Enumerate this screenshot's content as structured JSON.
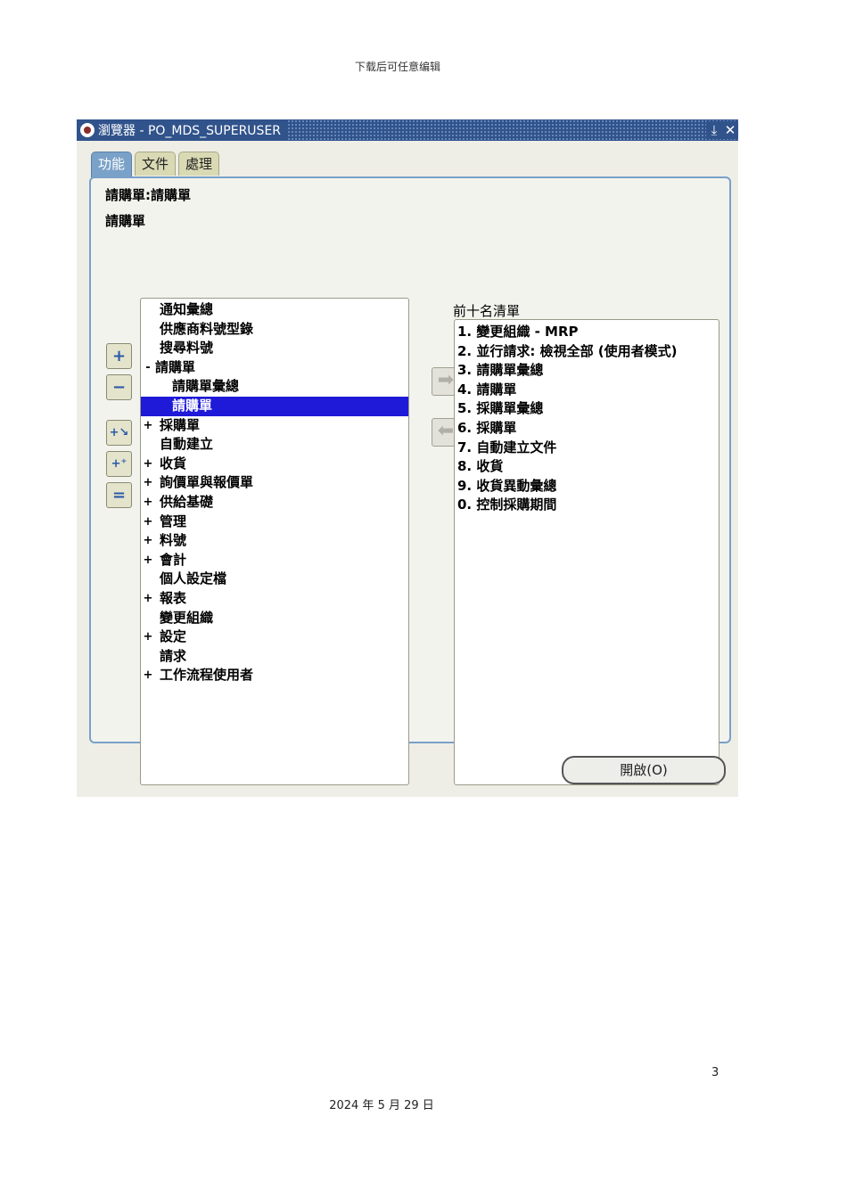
{
  "doc": {
    "header": "下载后可任意编辑",
    "page_number": "3",
    "footer": "2024 年 5 月 29 日"
  },
  "window": {
    "title": "瀏覽器 - PO_MDS_SUPERUSER",
    "tabs": [
      "功能",
      "文件",
      "處理"
    ],
    "active_tab": "功能",
    "path": "請購單:請購單",
    "subtitle": "請購單",
    "tree": [
      {
        "label": "通知彙總",
        "expander": "",
        "level": 0
      },
      {
        "label": "供應商料號型錄",
        "expander": "",
        "level": 0
      },
      {
        "label": "搜尋料號",
        "expander": "",
        "level": 0
      },
      {
        "label": "請購單",
        "expander": "-",
        "level": 0
      },
      {
        "label": "請購單彙總",
        "expander": "",
        "level": 1
      },
      {
        "label": "請購單",
        "expander": "",
        "level": 1,
        "selected": true
      },
      {
        "label": "採購單",
        "expander": "+",
        "level": 0
      },
      {
        "label": "自動建立",
        "expander": "",
        "level": 0
      },
      {
        "label": "收貨",
        "expander": "+",
        "level": 0
      },
      {
        "label": "詢價單與報價單",
        "expander": "+",
        "level": 0
      },
      {
        "label": "供給基礎",
        "expander": "+",
        "level": 0
      },
      {
        "label": "管理",
        "expander": "+",
        "level": 0
      },
      {
        "label": "料號",
        "expander": "+",
        "level": 0
      },
      {
        "label": "會計",
        "expander": "+",
        "level": 0
      },
      {
        "label": "個人設定檔",
        "expander": "",
        "level": 0
      },
      {
        "label": "報表",
        "expander": "+",
        "level": 0
      },
      {
        "label": "變更組織",
        "expander": "",
        "level": 0
      },
      {
        "label": "設定",
        "expander": "+",
        "level": 0
      },
      {
        "label": "請求",
        "expander": "",
        "level": 0
      },
      {
        "label": "工作流程使用者",
        "expander": "+",
        "level": 0
      }
    ],
    "top10_label": "前十名清單",
    "top10": [
      "1. 變更組織 - MRP",
      "2. 並行請求: 檢視全部 (使用者模式)",
      "3. 請購單彙總",
      "4. 請購單",
      "5. 採購單彙總",
      "6. 採購單",
      "7. 自動建立文件",
      "8. 收貨",
      "9. 收貨異動彙總",
      "0. 控制採購期間"
    ],
    "buttons": {
      "expand": "+",
      "collapse": "−",
      "expand_branch": "+↘",
      "expand_all": "+⁺",
      "collapse_all": "=",
      "add_to_top10": "➡",
      "remove_from_top10": "⬅",
      "open": "開啟(O)"
    },
    "colors": {
      "titlebar": "#31538c",
      "selection": "#1f19d8",
      "active_tab": "#7aa2c8",
      "panel_border": "#7aa0c8"
    }
  }
}
